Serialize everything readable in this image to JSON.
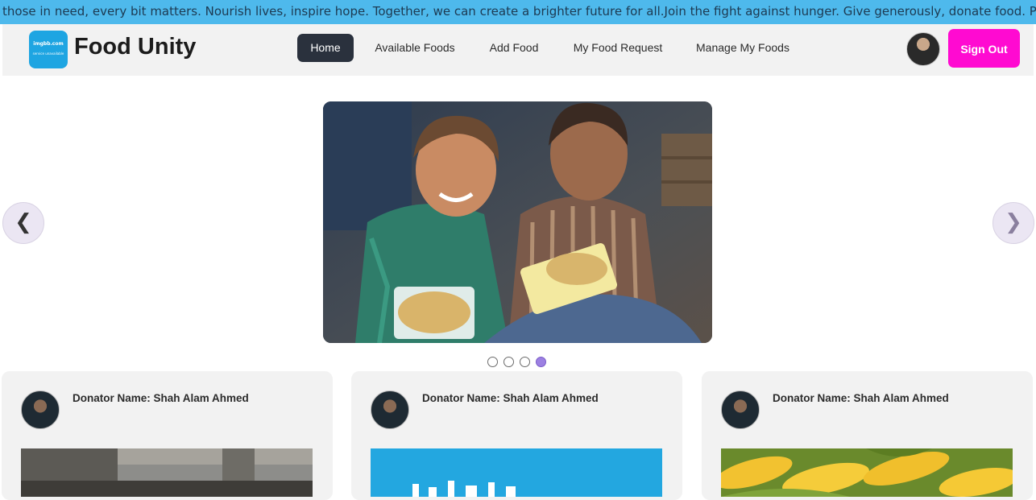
{
  "marquee": {
    "text": "those in need, every bit matters. Nourish lives, inspire hope. Together, we can create a brighter future for all.Join the fight against hunger. Give generously, donate food. Provide suste"
  },
  "navbar": {
    "logo": {
      "line1": "imgbb.com",
      "line2": "service unavailable"
    },
    "brand": "Food Unity",
    "items": [
      {
        "label": "Home",
        "active": true
      },
      {
        "label": "Available Foods",
        "active": false
      },
      {
        "label": "Add Food",
        "active": false
      },
      {
        "label": "My Food Request",
        "active": false
      },
      {
        "label": "Manage My Foods",
        "active": false
      }
    ],
    "signout_label": "Sign Out"
  },
  "carousel": {
    "prev_glyph": "❮",
    "next_glyph": "❯",
    "slide_count": 4,
    "active_index": 3
  },
  "cards": [
    {
      "donator": "Donator Name: Shah Alam Ahmed",
      "image": "grill-photo"
    },
    {
      "donator": "Donator Name: Shah Alam Ahmed",
      "image": "imgbb-placeholder"
    },
    {
      "donator": "Donator Name: Shah Alam Ahmed",
      "image": "corn-photo"
    }
  ],
  "colors": {
    "marquee_bg": "#4eb9ec",
    "nav_active": "#2a313d",
    "signout": "#ff0ad1",
    "dot_active": "#9c80e2"
  }
}
